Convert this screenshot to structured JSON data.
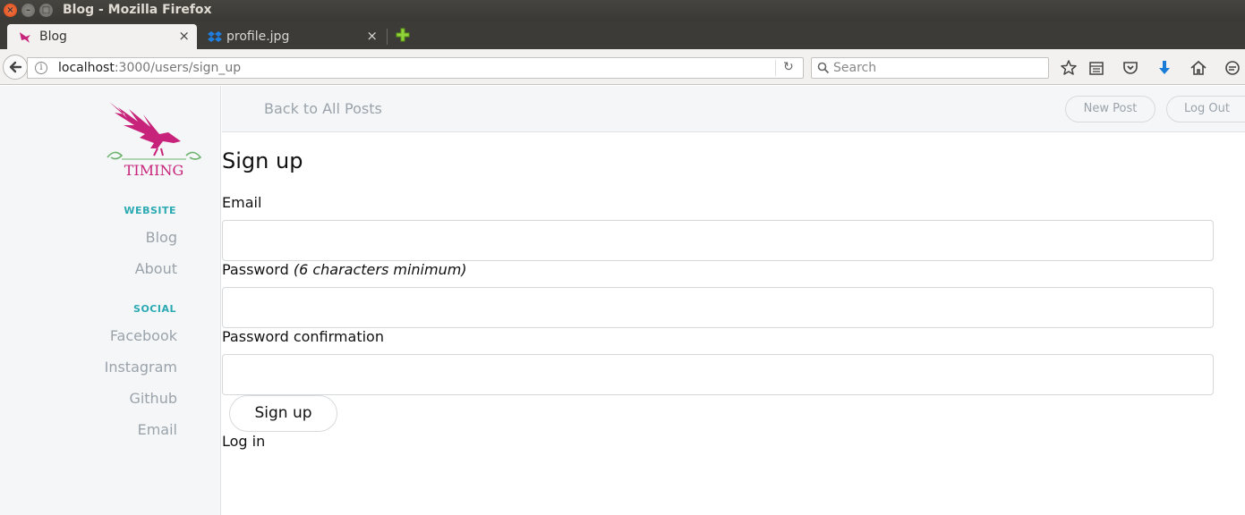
{
  "window": {
    "title": "Blog - Mozilla Firefox"
  },
  "tabs": [
    {
      "label": "Blog",
      "close": "×"
    },
    {
      "label": "profile.jpg",
      "close": "×"
    }
  ],
  "nav": {
    "url_host": "localhost",
    "url_path": ":3000/users/sign_up",
    "search_placeholder": "Search"
  },
  "sidebar": {
    "logo_text": "TIMING",
    "website_heading": "WEBSITE",
    "website_links": [
      "Blog",
      "About"
    ],
    "social_heading": "SOCIAL",
    "social_links": [
      "Facebook",
      "Instagram",
      "Github",
      "Email"
    ]
  },
  "topnav": {
    "back_link": "Back to All Posts",
    "new_post": "New Post",
    "log_out": "Log Out"
  },
  "form": {
    "title": "Sign up",
    "email_label": "Email",
    "password_label": "Password",
    "password_hint": "(6 characters minimum)",
    "password_confirmation_label": "Password confirmation",
    "submit_label": "Sign up",
    "login_link": "Log in"
  },
  "colors": {
    "accent": "#2baab3",
    "logo": "#c8237a",
    "link_muted": "#9aa3ab"
  }
}
